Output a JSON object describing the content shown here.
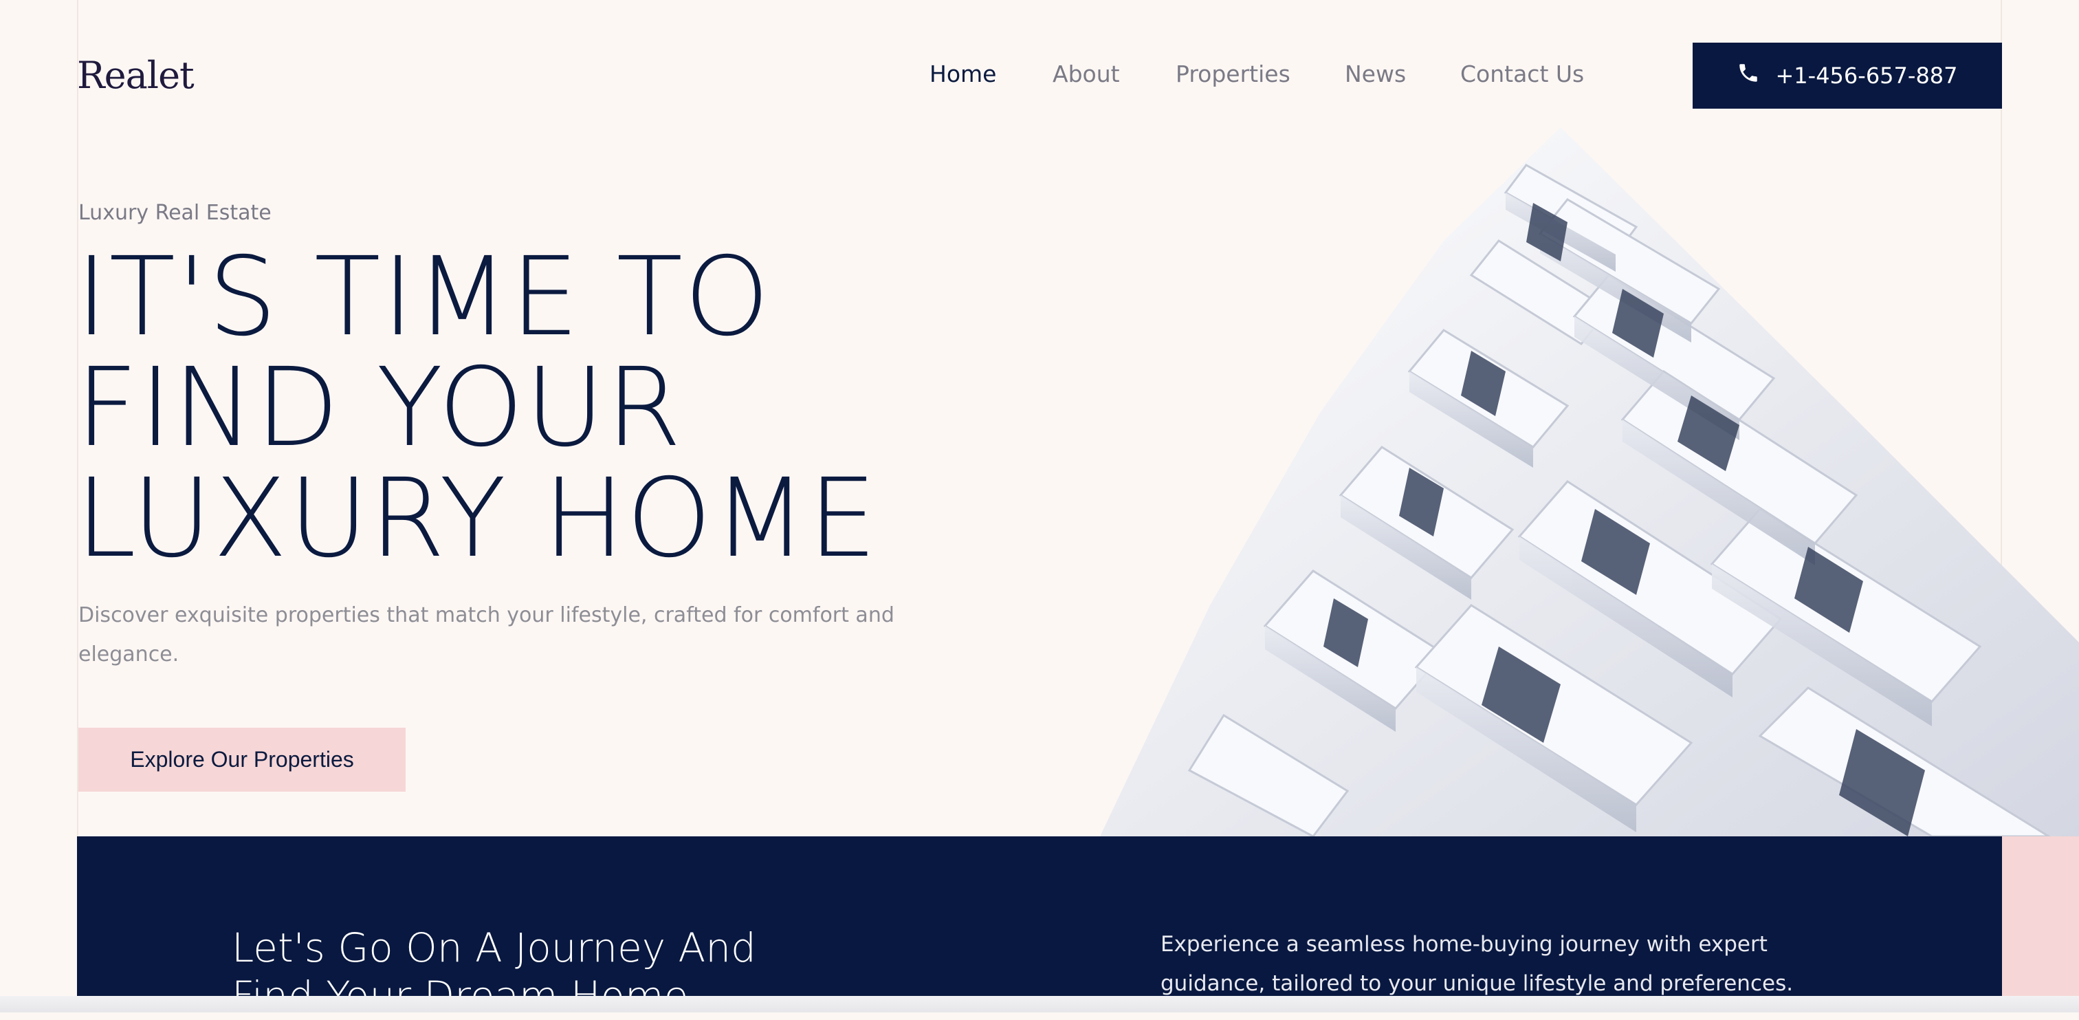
{
  "brand": {
    "logo_text": "Realet"
  },
  "nav": {
    "items": [
      {
        "label": "Home",
        "active": true
      },
      {
        "label": "About",
        "active": false
      },
      {
        "label": "Properties",
        "active": false
      },
      {
        "label": "News",
        "active": false
      },
      {
        "label": "Contact Us",
        "active": false
      }
    ]
  },
  "phone": {
    "label": "+1-456-657-887",
    "icon": "phone-icon"
  },
  "hero": {
    "eyebrow": "Luxury Real Estate",
    "title_lines": [
      "IT'S TIME TO",
      "FIND YOUR",
      "LUXURY HOME"
    ],
    "description": "Discover exquisite properties that match your lifestyle, crafted for comfort and elegance.",
    "cta_label": "Explore Our Properties",
    "image": "modern-white-apartment-building"
  },
  "journey": {
    "title_lines": [
      "Let's Go On A Journey And",
      "Find Your Dream Home"
    ],
    "description": "Experience a seamless home-buying journey with expert guidance, tailored to your unique lifestyle and preferences."
  },
  "colors": {
    "background": "#fdf7f4",
    "navy": "#091840",
    "pink": "#f6d6d6",
    "muted_text": "#7a7a86"
  }
}
